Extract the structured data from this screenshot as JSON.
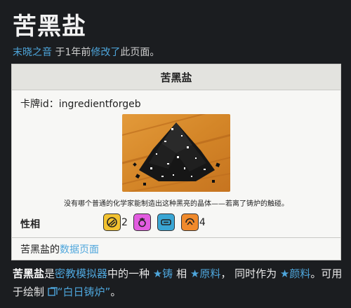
{
  "page": {
    "title": "苦黑盐",
    "editor": "末晓之音",
    "edit_mid": " 于1年前",
    "edit_link": "修改了",
    "edit_end": "此页面。"
  },
  "card": {
    "header": "苦黑盐",
    "id_label": "卡牌id：",
    "id_value": "ingredientforgeb",
    "flavor": "没有哪个普通的化学家能制造出这种黑亮的晶体——若离了铸炉的触碰。",
    "aspect_label": "性相",
    "aspects": [
      {
        "icon": "forge-aspect-icon",
        "color": "#f2c230",
        "value": "2"
      },
      {
        "icon": "moth-aspect-icon",
        "color": "#e25ce0",
        "value": ""
      },
      {
        "icon": "knock-aspect-icon",
        "color": "#3aa6d4",
        "value": ""
      },
      {
        "icon": "winter-aspect-icon",
        "color": "#f08a2c",
        "value": "4"
      }
    ],
    "footer_prefix": "苦黑盐的",
    "footer_link": "数据页面"
  },
  "description": {
    "name": "苦黑盐",
    "t1": "是",
    "game_link": "密教模拟器",
    "t2": "中的一种",
    "tag1": "铸",
    "t3": " 相 ",
    "tag2": "原料",
    "t4": "， 同时作为 ",
    "tag3": "颜料",
    "t5": "。可用于绘制 ",
    "recipe": "“白日铸炉”",
    "t6": "。"
  },
  "colors": {
    "background": "#1b1d20",
    "link": "#4ea6dc",
    "card_bg": "#f7f7f5",
    "card_header": "#e3e3df"
  }
}
